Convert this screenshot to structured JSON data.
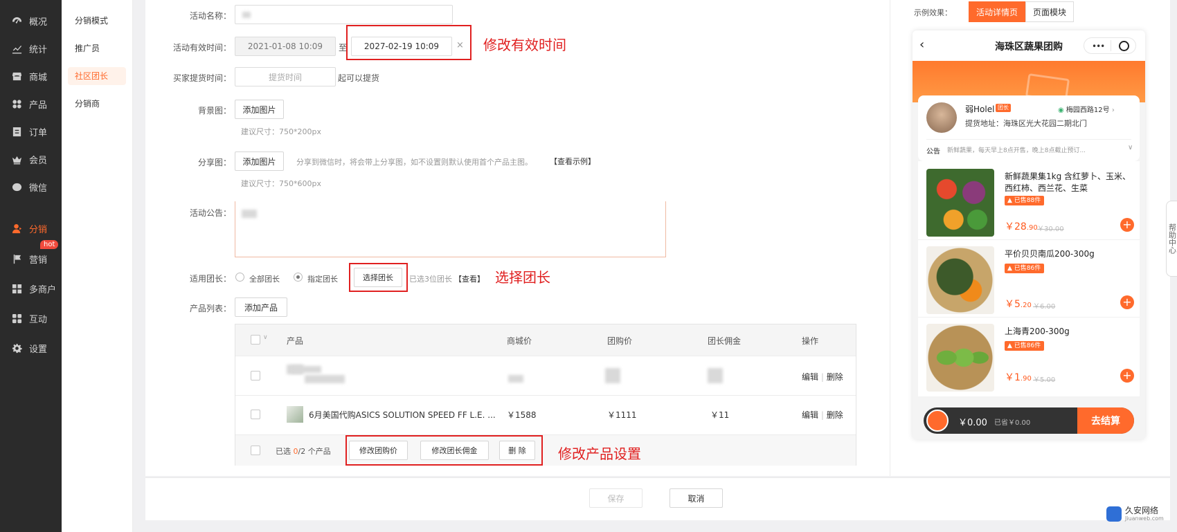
{
  "sidebar": {
    "items": [
      {
        "label": "概况",
        "icon": "dashboard-icon"
      },
      {
        "label": "统计",
        "icon": "chart-icon"
      },
      {
        "label": "商城",
        "icon": "store-icon"
      },
      {
        "label": "产品",
        "icon": "grid-icon"
      },
      {
        "label": "订单",
        "icon": "order-icon"
      },
      {
        "label": "会员",
        "icon": "crown-icon"
      },
      {
        "label": "微信",
        "icon": "wechat-icon"
      },
      {
        "label": "分销",
        "icon": "user-share-icon"
      },
      {
        "label": "营销",
        "icon": "flag-icon"
      },
      {
        "label": "多商户",
        "icon": "multi-store-icon"
      },
      {
        "label": "互动",
        "icon": "interact-icon"
      },
      {
        "label": "设置",
        "icon": "gear-icon"
      }
    ],
    "hot_badge": "hot"
  },
  "submenu": {
    "items": [
      "分销模式",
      "推广员",
      "社区团长",
      "分销商"
    ]
  },
  "form": {
    "activity_name_label": "活动名称：",
    "valid_time_label": "活动有效时间：",
    "start_time": "2021-01-08 10:09",
    "to_label": "至",
    "end_time": "2027-02-19 10:09",
    "clear_symbol": "×",
    "pickup_label": "买家提货时间：",
    "pickup_placeholder": "提货时间",
    "pickup_suffix": "起可以提货",
    "bg_label": "背景图：",
    "add_image": "添加图片",
    "bg_hint": "建议尺寸：750*200px",
    "share_label": "分享图：",
    "share_desc": "分享到微信时，将会带上分享图，如不设置则默认使用首个产品主图。",
    "share_example": "【查看示例】",
    "share_hint": "建议尺寸：750*600px",
    "notice_label": "活动公告：",
    "leader_label": "适用团长：",
    "leader_all": "全部团长",
    "leader_specified": "指定团长",
    "choose_leader": "选择团长",
    "selected_leaders": "已选3位团长",
    "view_link": "【查看】",
    "product_list_label": "产品列表：",
    "add_product": "添加产品"
  },
  "annotations": {
    "modify_time": "修改有效时间",
    "choose_leader": "选择团长",
    "modify_product": "修改产品设置"
  },
  "table": {
    "headers": [
      "产品",
      "商城价",
      "团购价",
      "团长佣金",
      "操作"
    ],
    "rows": [
      {
        "name": "",
        "mall_price": "",
        "group_price": "",
        "commission": "",
        "actions": [
          "编辑",
          "删除"
        ]
      },
      {
        "name": "6月美国代购ASICS SOLUTION SPEED FF L.E. ...",
        "mall_price": "￥1588",
        "group_price": "￥1111",
        "commission": "￥11",
        "actions": [
          "编辑",
          "删除"
        ]
      }
    ],
    "footer": {
      "selected_prefix": "已选",
      "selected_count": "0",
      "selected_total": "/2 个产品",
      "modify_group_price": "修改团购价",
      "modify_commission": "修改团长佣金",
      "delete": "删 除"
    }
  },
  "footer": {
    "save": "保存",
    "cancel": "取消"
  },
  "preview": {
    "label": "示例效果：",
    "tab_active": "活动详情页",
    "tab_inactive": "页面模块",
    "phone_title": "海珠区蔬果团购",
    "leader_name": "弱Holel",
    "leader_badge": "团长",
    "leader_location": "梅园西路12号",
    "pickup_address": "提货地址：海珠区光大花园二期北门",
    "notice_label": "公告",
    "notice_text": "新鲜蔬果，每天早上8点开售，晚上8点截止预订...",
    "products": [
      {
        "name": "新鲜蔬果集1kg 含红萝卜、玉米、西红柿、西兰花、生菜",
        "sold": "已售88件",
        "price_int": "28",
        "price_dec": ".90",
        "old_price": "￥30.00"
      },
      {
        "name": "平价贝贝南瓜200-300g",
        "sold": "已售86件",
        "price_int": "5",
        "price_dec": ".20",
        "old_price": "￥6.00"
      },
      {
        "name": "上海青200-300g",
        "sold": "已售86件",
        "price_int": "1",
        "price_dec": ".90",
        "old_price": "￥5.00"
      }
    ],
    "cart_total": "￥0.00",
    "cart_saved": "已省￥0.00",
    "checkout": "去结算"
  },
  "help_float": "帮助中心",
  "watermark": {
    "name": "久安网络",
    "url": "Jiuanweb.com"
  },
  "colors": {
    "accent": "#ff6a2c",
    "annotation_red": "#e02020",
    "sidebar_bg": "#2b2b2b"
  }
}
